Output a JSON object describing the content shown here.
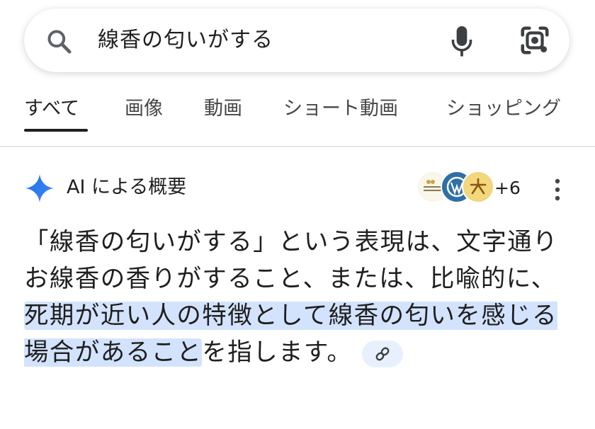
{
  "search": {
    "query": "線香の匂いがする",
    "icons": {
      "search": "search-icon",
      "voice": "mic-icon",
      "lens": "camera-lens-icon"
    }
  },
  "tabs": [
    {
      "label": "すべて",
      "active": true
    },
    {
      "label": "画像",
      "active": false
    },
    {
      "label": "動画",
      "active": false
    },
    {
      "label": "ショート動画",
      "active": false
    },
    {
      "label": "ショッピング",
      "active": false
    }
  ],
  "ai_overview": {
    "title": "AI による概要",
    "sources_more": "+6",
    "text_before": "「線香の匂いがする」という表現は、文字通りお線香の香りがすること、または、比喩的に、",
    "text_highlight": "死期が近い人の特徴として線香の匂いを感じる場合があること",
    "text_after": "を指します。",
    "link_icon": "link-icon"
  },
  "colors": {
    "highlight": "#d3e3fd",
    "gemini_blue": "#4285f4",
    "chip_bg": "#e8f0fe",
    "text": "#1f1f1f"
  }
}
